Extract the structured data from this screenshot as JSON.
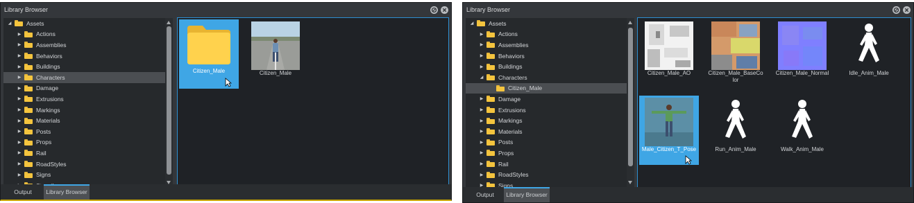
{
  "left_panel": {
    "title": "Library Browser",
    "tree": [
      {
        "label": "Assets",
        "arrow": "open",
        "indent": 0
      },
      {
        "label": "Actions",
        "arrow": "closed",
        "indent": 1
      },
      {
        "label": "Assemblies",
        "arrow": "closed",
        "indent": 1
      },
      {
        "label": "Behaviors",
        "arrow": "closed",
        "indent": 1
      },
      {
        "label": "Buildings",
        "arrow": "closed",
        "indent": 1
      },
      {
        "label": "Characters",
        "arrow": "closed",
        "indent": 1,
        "selected": true
      },
      {
        "label": "Damage",
        "arrow": "closed",
        "indent": 1
      },
      {
        "label": "Extrusions",
        "arrow": "closed",
        "indent": 1
      },
      {
        "label": "Markings",
        "arrow": "closed",
        "indent": 1
      },
      {
        "label": "Materials",
        "arrow": "closed",
        "indent": 1
      },
      {
        "label": "Posts",
        "arrow": "closed",
        "indent": 1
      },
      {
        "label": "Props",
        "arrow": "closed",
        "indent": 1
      },
      {
        "label": "Rail",
        "arrow": "closed",
        "indent": 1
      },
      {
        "label": "RoadStyles",
        "arrow": "closed",
        "indent": 1
      },
      {
        "label": "Signs",
        "arrow": "closed",
        "indent": 1
      },
      {
        "label": "Stencils",
        "arrow": "closed",
        "indent": 1
      }
    ],
    "tiles": [
      {
        "label": "Citizen_Male",
        "kind": "folder",
        "selected": true
      },
      {
        "label": "Citizen_Male",
        "kind": "character-photo",
        "selected": false
      }
    ],
    "tabs": [
      "Output",
      "Library Browser"
    ],
    "active_tab": "Library Browser"
  },
  "right_panel": {
    "title": "Library Browser",
    "tree": [
      {
        "label": "Assets",
        "arrow": "open",
        "indent": 0
      },
      {
        "label": "Actions",
        "arrow": "closed",
        "indent": 1
      },
      {
        "label": "Assemblies",
        "arrow": "closed",
        "indent": 1
      },
      {
        "label": "Behaviors",
        "arrow": "closed",
        "indent": 1
      },
      {
        "label": "Buildings",
        "arrow": "closed",
        "indent": 1
      },
      {
        "label": "Characters",
        "arrow": "open",
        "indent": 1
      },
      {
        "label": "Citizen_Male",
        "arrow": "none",
        "indent": 2,
        "selected": true
      },
      {
        "label": "Damage",
        "arrow": "closed",
        "indent": 1
      },
      {
        "label": "Extrusions",
        "arrow": "closed",
        "indent": 1
      },
      {
        "label": "Markings",
        "arrow": "closed",
        "indent": 1
      },
      {
        "label": "Materials",
        "arrow": "closed",
        "indent": 1
      },
      {
        "label": "Posts",
        "arrow": "closed",
        "indent": 1
      },
      {
        "label": "Props",
        "arrow": "closed",
        "indent": 1
      },
      {
        "label": "Rail",
        "arrow": "closed",
        "indent": 1
      },
      {
        "label": "RoadStyles",
        "arrow": "closed",
        "indent": 1
      },
      {
        "label": "Signs",
        "arrow": "closed",
        "indent": 1
      }
    ],
    "tiles": [
      {
        "label": "Citizen_Male_AO",
        "kind": "texture-ao",
        "selected": false
      },
      {
        "label": "Citizen_Male_BaseColor",
        "kind": "texture-basecolor",
        "selected": false
      },
      {
        "label": "Citizen_Male_Normal",
        "kind": "texture-normal",
        "selected": false
      },
      {
        "label": "Idle_Anim_Male",
        "kind": "anim-walk",
        "selected": false
      },
      {
        "label": "Male_Citizen_T_Pose",
        "kind": "tpose-photo",
        "selected": true
      },
      {
        "label": "Run_Anim_Male",
        "kind": "anim-walk",
        "selected": false
      },
      {
        "label": "Walk_Anim_Male",
        "kind": "anim-walk",
        "selected": false
      }
    ],
    "tabs": [
      "Output",
      "Library Browser"
    ],
    "active_tab": "Library Browser"
  },
  "icons": {
    "pin": "pin-icon",
    "close": "close-icon",
    "folder": "folder-icon",
    "expand": "triangle-expand-icon",
    "collapse": "triangle-collapse-icon",
    "cursor": "mouse-cursor-icon",
    "walk": "walking-figure-icon"
  },
  "colors": {
    "panel_bg": "#34373b",
    "tree_bg": "#26292c",
    "content_bg": "#1f2226",
    "accent": "#3fa6e5",
    "folder": "#f4c43e",
    "active_border": "#c8a400"
  }
}
